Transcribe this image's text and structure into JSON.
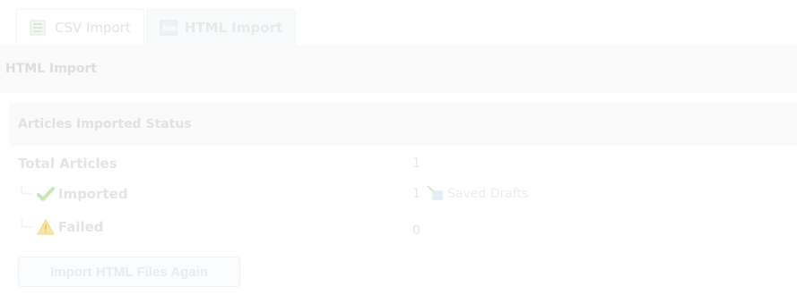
{
  "tabs": [
    {
      "label": "CSV Import",
      "icon": "csv-icon",
      "active": false
    },
    {
      "label": "HTML Import",
      "icon": "html-icon",
      "active": true
    }
  ],
  "section": {
    "title": "HTML Import"
  },
  "status": {
    "title": "Articles Imported Status",
    "total_label": "Total Articles",
    "total_value": "1",
    "imported_label": "Imported",
    "imported_value": "1",
    "imported_link": "Saved Drafts",
    "failed_label": "Failed",
    "failed_value": "0"
  },
  "actions": {
    "import_again": "Import HTML Files Again"
  },
  "colors": {
    "success": "#c9e6b8",
    "warning": "#f7e6a8",
    "link": "#e6eef3"
  }
}
